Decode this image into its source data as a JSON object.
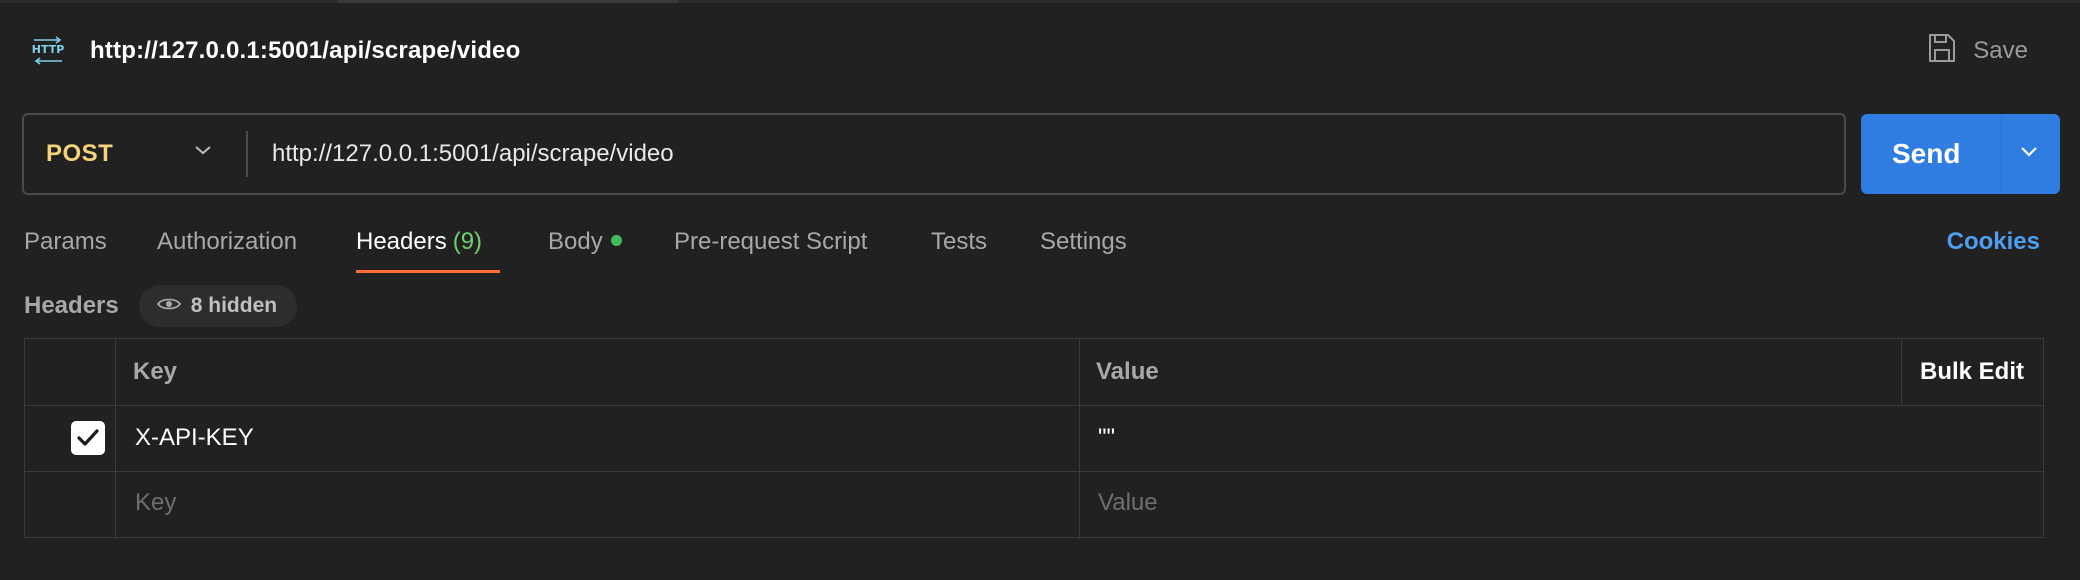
{
  "request": {
    "title": "http://127.0.0.1:5001/api/scrape/video",
    "save_label": "Save",
    "method": "POST",
    "url": "http://127.0.0.1:5001/api/scrape/video",
    "send_label": "Send"
  },
  "tabs": [
    {
      "label": "Params"
    },
    {
      "label": "Authorization"
    },
    {
      "label": "Headers",
      "count": "(9)",
      "active": true
    },
    {
      "label": "Body",
      "indicator": "green-dot"
    },
    {
      "label": "Pre-request Script"
    },
    {
      "label": "Tests"
    },
    {
      "label": "Settings"
    }
  ],
  "cookies_label": "Cookies",
  "headers_section": {
    "title": "Headers",
    "hidden_label": "8 hidden",
    "columns": {
      "key": "Key",
      "value": "Value",
      "bulk_edit": "Bulk Edit"
    },
    "rows": [
      {
        "checked": true,
        "key": "X-API-KEY",
        "value": "\"\""
      }
    ],
    "new_row": {
      "key_placeholder": "Key",
      "value_placeholder": "Value"
    }
  },
  "colors": {
    "background": "#212121",
    "method_post": "#f5d37a",
    "send_button": "#2f7de1",
    "active_tab_underline": "#ff6c37",
    "headers_count": "#6fcf6f",
    "body_dot": "#3dbe5a",
    "cookies_link": "#4f9ef0"
  },
  "icons": {
    "request_type": "http-icon",
    "save": "save-icon",
    "method_dropdown": "chevron-down-icon",
    "send_dropdown": "chevron-down-icon",
    "hidden_headers": "eye-icon",
    "row_checkbox": "checkmark-icon"
  }
}
